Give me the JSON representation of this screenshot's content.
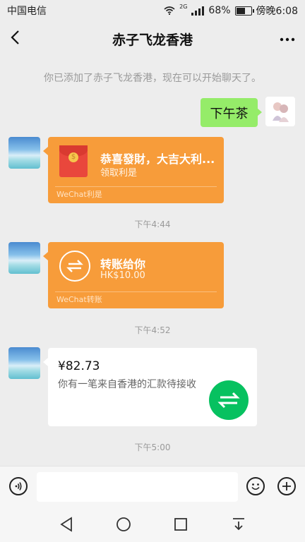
{
  "status": {
    "carrier": "中国电信",
    "network": "2G",
    "battery": "68%",
    "time": "傍晚6:08",
    "battery_level": 0.68
  },
  "header": {
    "title": "赤子飞龙香港"
  },
  "system_message": "你已添加了赤子飞龙香港，现在可以开始聊天了。",
  "messages": {
    "sent_text": "下午茶",
    "red_packet": {
      "title": "恭喜發財，大吉大利...",
      "subtitle": "领取利是",
      "footer": "WeChat利是"
    },
    "time1": "下午4:44",
    "transfer": {
      "title": "转账给你",
      "amount": "HK$10.00",
      "footer": "WeChat转账"
    },
    "time2": "下午4:52",
    "remittance": {
      "amount": "¥82.73",
      "description": "你有一笔来自香港的汇款待接收"
    },
    "time3": "下午5:00"
  },
  "input": {
    "value": ""
  },
  "colors": {
    "orange_card": "#f79c3a",
    "green_bubble": "#95ec69",
    "wechat_green": "#07c160"
  },
  "icons": [
    "back-arrow-icon",
    "more-dots-icon",
    "voice-icon",
    "emoji-icon",
    "plus-icon",
    "red-packet-icon",
    "transfer-icon",
    "nav-back-icon",
    "nav-home-icon",
    "nav-recents-icon",
    "nav-dropdown-icon"
  ]
}
